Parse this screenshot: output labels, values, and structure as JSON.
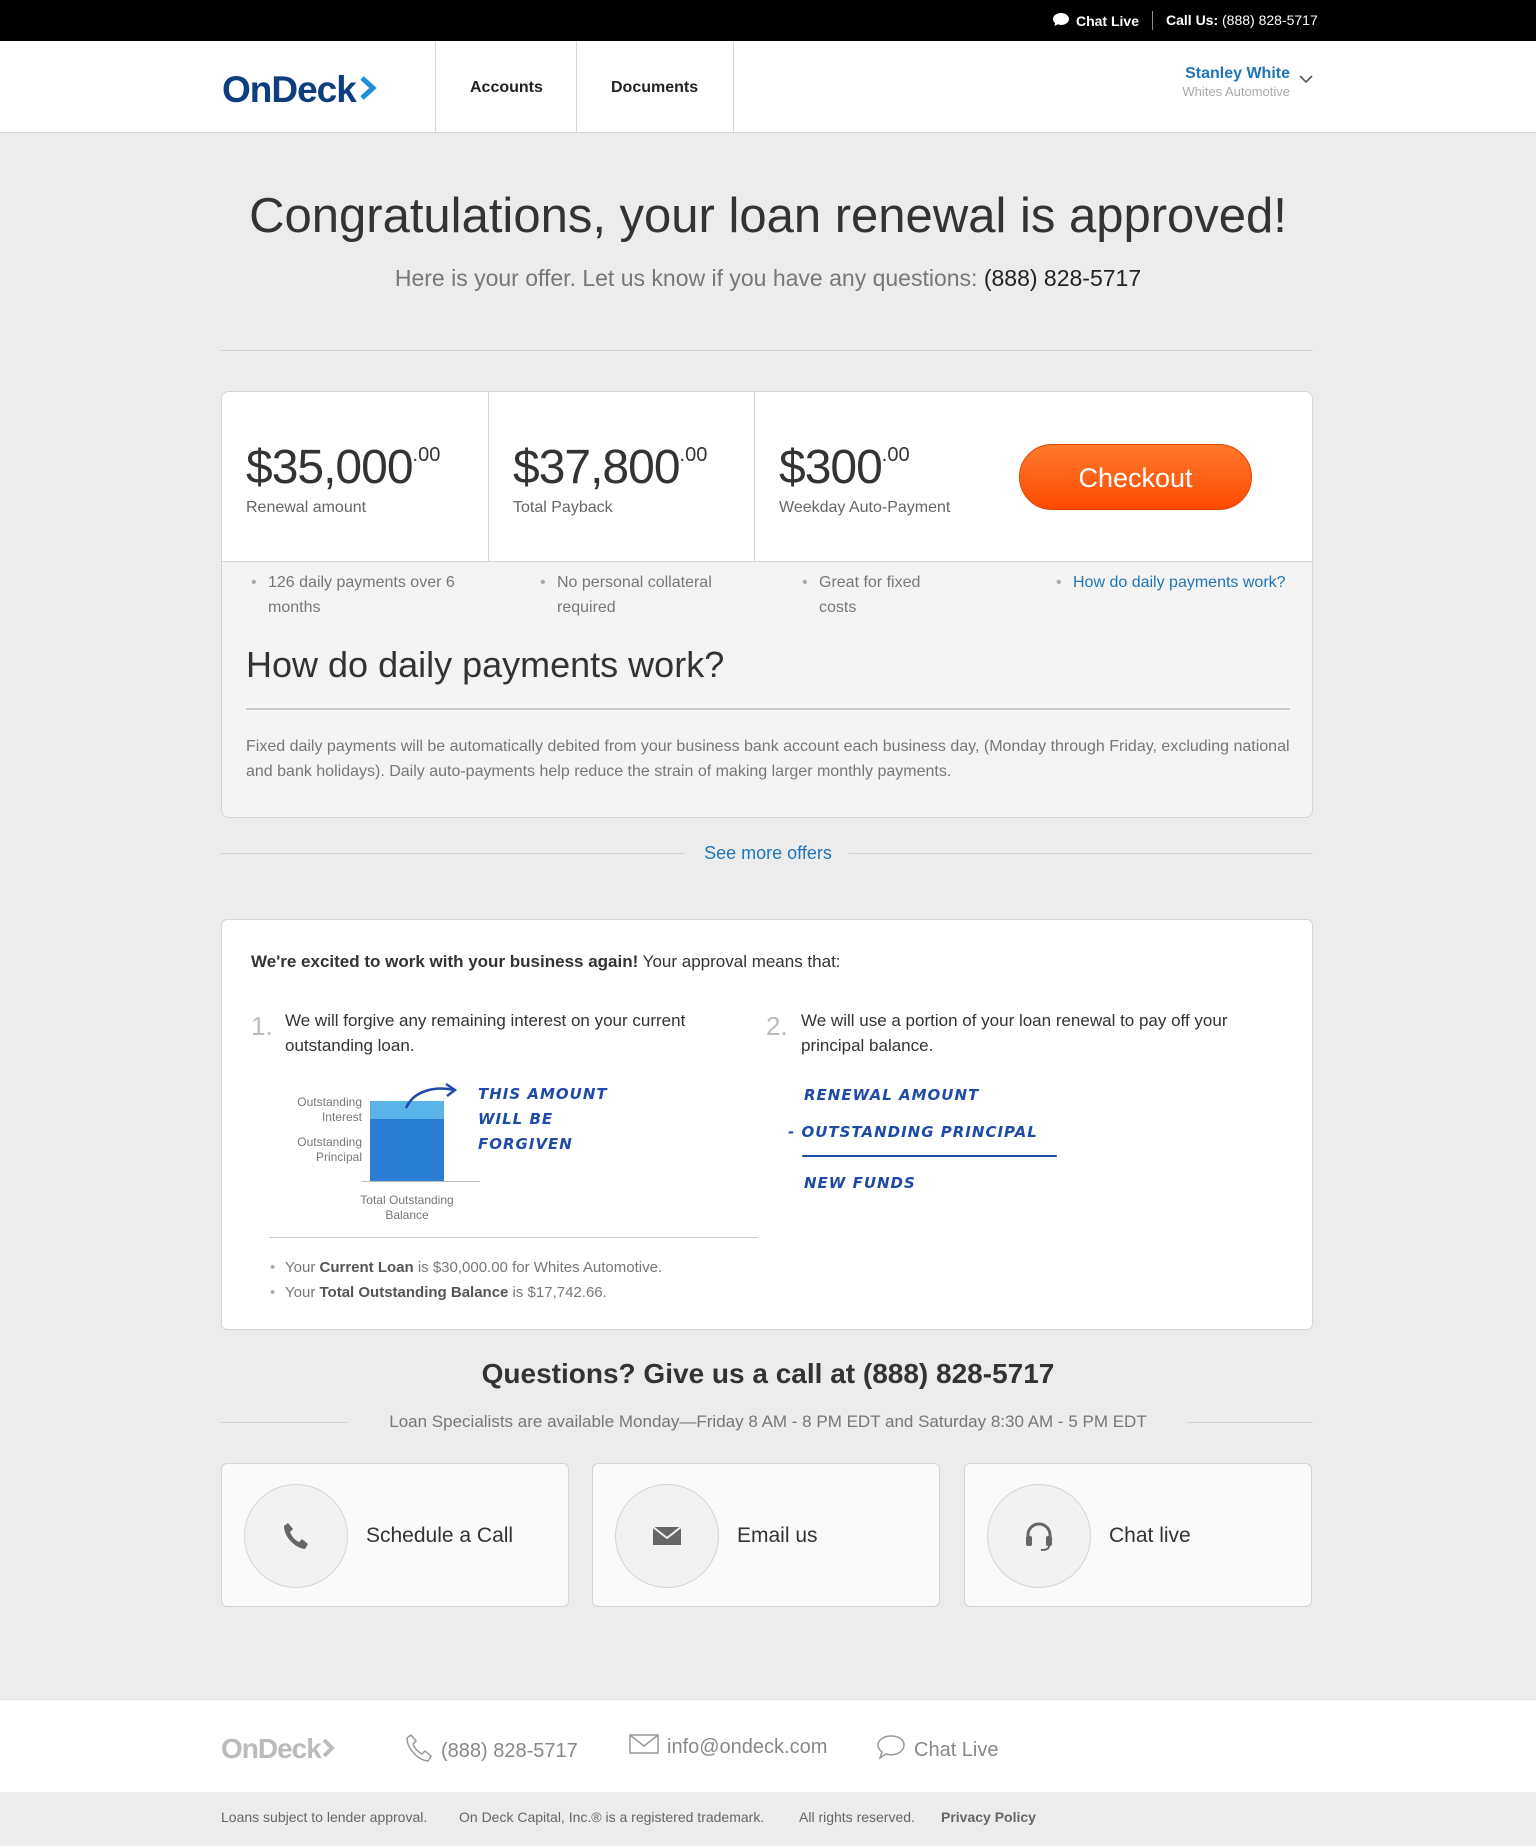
{
  "topbar": {
    "chat_label": "Chat Live",
    "call_label": "Call Us:",
    "call_number": "(888) 828-5717"
  },
  "header": {
    "logo": "OnDeck",
    "nav": [
      "Accounts",
      "Documents"
    ],
    "user_name": "Stanley White",
    "user_business": "Whites Automotive"
  },
  "hero": {
    "title": "Congratulations, your loan renewal is approved!",
    "subtitle": "Here is your offer. Let us know if you have any questions:",
    "phone": "(888) 828-5717"
  },
  "offer": {
    "renewal": {
      "amount": "$35,000",
      "cents": ".00",
      "label": "Renewal amount"
    },
    "payback": {
      "amount": "$37,800",
      "cents": ".00",
      "label": "Total Payback"
    },
    "payment": {
      "amount": "$300",
      "cents": ".00",
      "label": "Weekday Auto-Payment"
    },
    "checkout_label": "Checkout",
    "bullets": [
      "126 daily payments over 6 months",
      "No personal collateral required",
      "Great for fixed costs"
    ],
    "help_link": "How do daily payments work?",
    "explain_title": "How do daily payments work?",
    "explain_text": "Fixed daily payments will be automatically debited from your business bank account each business day, (Monday through Friday, excluding national and bank holidays). Daily auto-payments help reduce the strain of making larger monthly payments."
  },
  "see_more": "See more offers",
  "approval": {
    "intro_bold": "We're excited to work with your business again!",
    "intro_rest": " Your approval means that:",
    "point1_num": "1.",
    "point1": "We will forgive any remaining interest on your current outstanding loan.",
    "point2_num": "2.",
    "point2": "We will use a portion of your loan renewal to pay off your principal balance.",
    "diagram": {
      "label_interest_1": "Outstanding",
      "label_interest_2": "Interest",
      "label_principal_1": "Outstanding",
      "label_principal_2": "Principal",
      "label_total_1": "Total Outstanding",
      "label_total_2": "Balance",
      "note_1": "THIS AMOUNT",
      "note_2": "WILL BE",
      "note_3": "FORGIVEN",
      "interest_color": "#5ab4e8",
      "principal_color": "#2a7fd4"
    },
    "formula": {
      "line1": "RENEWAL AMOUNT",
      "line2": "- OUTSTANDING PRINCIPAL",
      "line3": "NEW FUNDS"
    },
    "facts": [
      {
        "pre": "Your ",
        "bold": "Current Loan",
        "post": " is $30,000.00 for Whites Automotive."
      },
      {
        "pre": "Your ",
        "bold": "Total Outstanding Balance",
        "post": " is $17,742.66."
      }
    ]
  },
  "questions": {
    "title": "Questions? Give us a call at (888) 828-5717",
    "hours": "Loan Specialists are available Monday—Friday 8 AM - 8 PM EDT and Saturday 8:30 AM - 5 PM EDT",
    "cards": [
      {
        "label": "Schedule a Call",
        "icon": "phone-icon"
      },
      {
        "label": "Email us",
        "icon": "envelope-icon"
      },
      {
        "label": "Chat live",
        "icon": "headset-icon"
      }
    ]
  },
  "footer": {
    "logo": "OnDeck",
    "phone": "(888) 828-5717",
    "email": "info@ondeck.com",
    "chat": "Chat Live",
    "legal": [
      "Loans subject to lender approval.",
      "On Deck Capital, Inc.® is a registered trademark.",
      "All rights reserved.",
      "Privacy Policy"
    ]
  },
  "colors": {
    "accent": "#1f75b8",
    "checkout": "#ff5a10",
    "brand_dark": "#0d3f7e"
  }
}
